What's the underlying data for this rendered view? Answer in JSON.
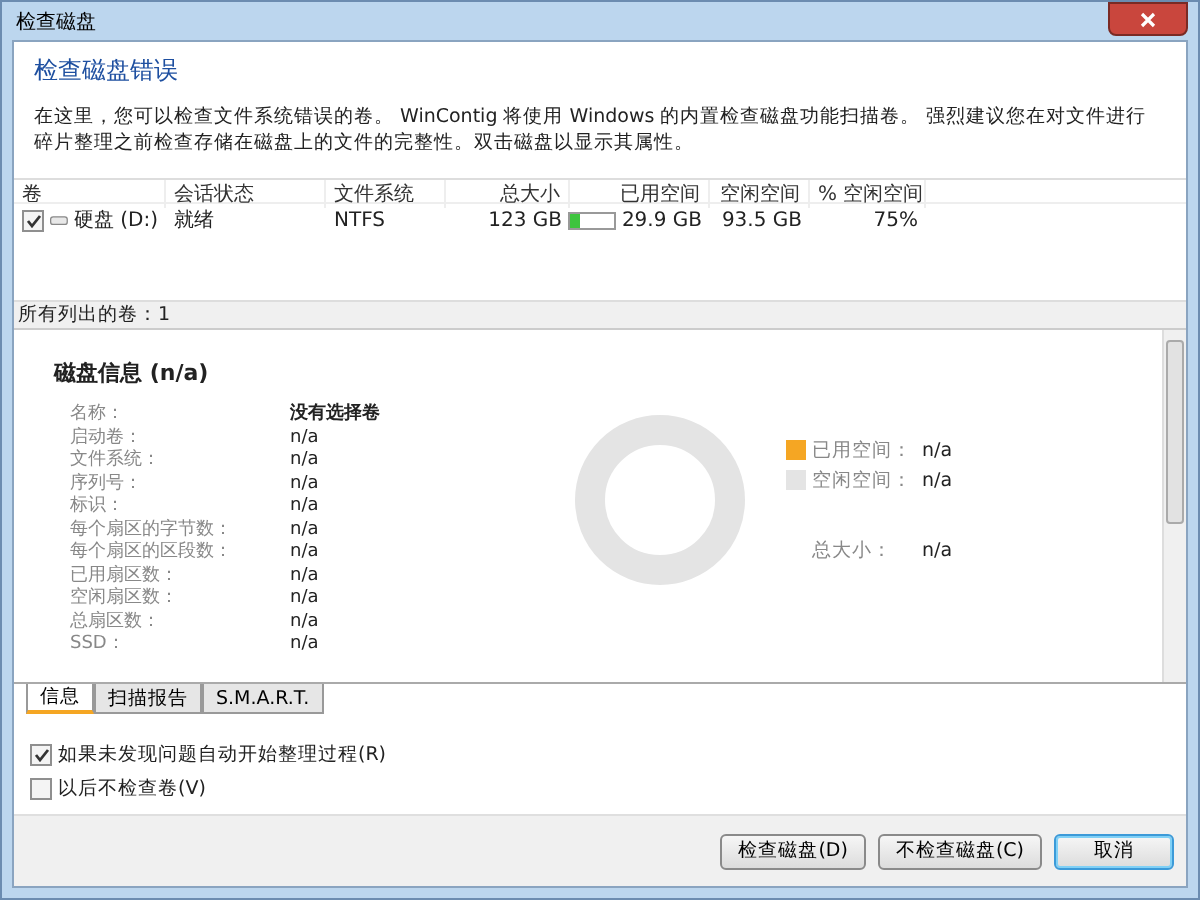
{
  "window": {
    "title": "检查磁盘"
  },
  "header": {
    "title": "检查磁盘错误",
    "description": "在这里，您可以检查文件系统错误的卷。 WinContig 将使用 Windows 的内置检查磁盘功能扫描卷。 强烈建议您在对文件进行碎片整理之前检查存储在磁盘上的文件的完整性。双击磁盘以显示其属性。"
  },
  "table": {
    "columns": [
      "卷",
      "会话状态",
      "文件系统",
      "总大小",
      "已用空间",
      "空闲空间",
      "% 空闲空间"
    ],
    "rows": [
      {
        "checked": true,
        "volume": "硬盘 (D:)",
        "status": "就绪",
        "filesystem": "NTFS",
        "total": "123 GB",
        "level": 0.24,
        "used": "29.9 GB",
        "free": "93.5 GB",
        "free_pct": "75%"
      }
    ]
  },
  "status_bar": "所有列出的卷：1",
  "info": {
    "title": "磁盘信息 (n/a)",
    "fields": [
      {
        "label": "名称：",
        "value": "没有选择卷",
        "kind": "bold"
      },
      {
        "label": "启动卷：",
        "value": "n/a",
        "kind": "plain"
      },
      {
        "label": "文件系统：",
        "value": "n/a",
        "kind": "plain"
      },
      {
        "label": "序列号：",
        "value": "n/a",
        "kind": "plain"
      },
      {
        "label": "标识：",
        "value": "n/a",
        "kind": "plain"
      },
      {
        "label": "每个扇区的字节数：",
        "value": "n/a",
        "kind": "plain"
      },
      {
        "label": "每个扇区的区段数：",
        "value": "n/a",
        "kind": "plain"
      },
      {
        "label": "已用扇区数：",
        "value": "n/a",
        "kind": "plain"
      },
      {
        "label": "空闲扇区数：",
        "value": "n/a",
        "kind": "plain"
      },
      {
        "label": "总扇区数：",
        "value": "n/a",
        "kind": "plain"
      },
      {
        "label": "SSD：",
        "value": "n/a",
        "kind": "plain"
      }
    ],
    "legend": [
      {
        "label": "已用空间：",
        "value": "n/a",
        "color": "#f5a623"
      },
      {
        "label": "空闲空间：",
        "value": "n/a",
        "color": "#e4e4e4"
      }
    ],
    "total": {
      "label": "总大小：",
      "value": "n/a"
    }
  },
  "tabs": [
    {
      "label": "信息",
      "selected": true
    },
    {
      "label": "扫描报告",
      "selected": false
    },
    {
      "label": "S.M.A.R.T.",
      "selected": false
    }
  ],
  "options": [
    {
      "label": "如果未发现问题自动开始整理过程(R)",
      "checked": true
    },
    {
      "label": "以后不检查卷(V)",
      "checked": false
    }
  ],
  "buttons": [
    {
      "label": "检查磁盘(D)",
      "default": false
    },
    {
      "label": "不检查磁盘(C)",
      "default": false
    },
    {
      "label": "取消",
      "default": true
    }
  ]
}
